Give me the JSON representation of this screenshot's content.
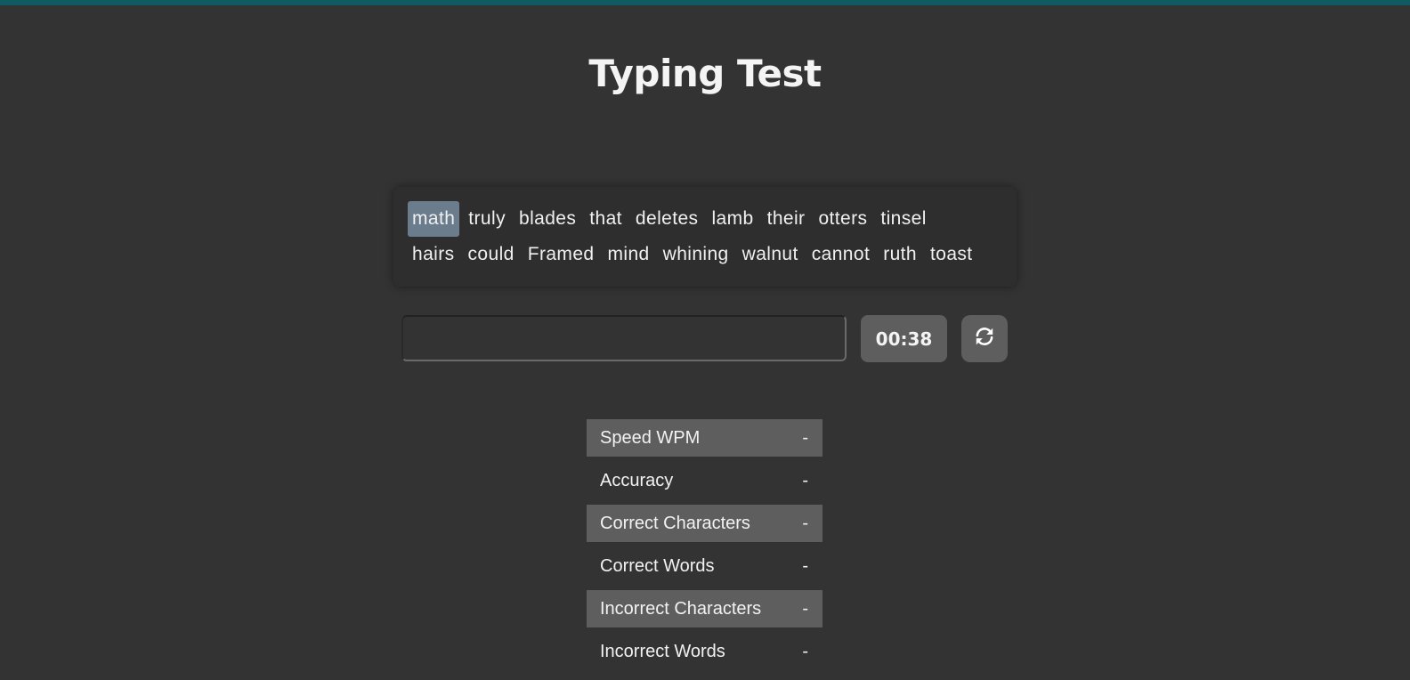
{
  "app": {
    "title": "Typing Test"
  },
  "colors": {
    "background": "#333333",
    "accent_bar": "#0f5a63",
    "current_word_highlight": "#6b7d8d",
    "panel": "#5e5e5e"
  },
  "words": {
    "current_index": 0,
    "line1": [
      "math",
      "truly",
      "blades",
      "that",
      "deletes",
      "lamb",
      "their",
      "otters",
      "tinsel"
    ],
    "line2": [
      "hairs",
      "could",
      "Framed",
      "mind",
      "whining",
      "walnut",
      "cannot",
      "ruth",
      "toast"
    ]
  },
  "input": {
    "value": "",
    "placeholder": ""
  },
  "timer": {
    "display": "00:38"
  },
  "reset_button": {
    "icon": "refresh-icon"
  },
  "stats": [
    {
      "label": "Speed WPM",
      "value": "-"
    },
    {
      "label": "Accuracy",
      "value": "-"
    },
    {
      "label": "Correct Characters",
      "value": "-"
    },
    {
      "label": "Correct Words",
      "value": "-"
    },
    {
      "label": "Incorrect Characters",
      "value": "-"
    },
    {
      "label": "Incorrect Words",
      "value": "-"
    }
  ]
}
